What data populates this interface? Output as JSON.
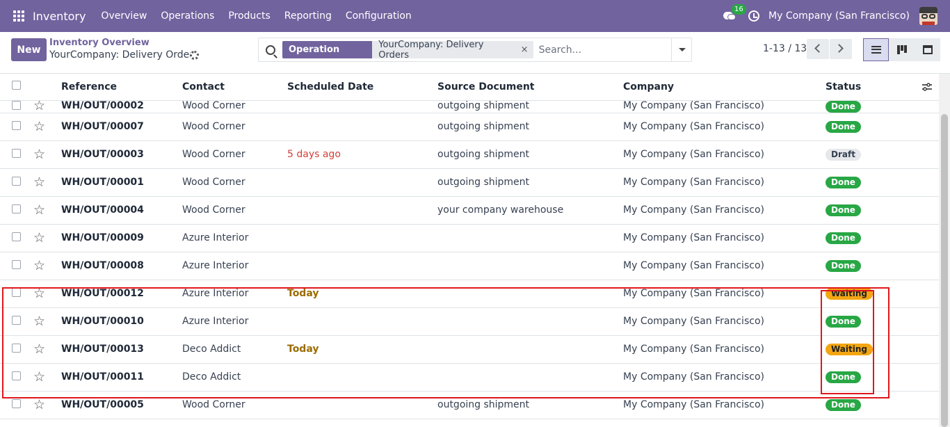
{
  "topbar": {
    "app_name": "Inventory",
    "menu": [
      "Overview",
      "Operations",
      "Products",
      "Reporting",
      "Configuration"
    ],
    "chat_count": "16",
    "company": "My Company (San Francisco)",
    "bg_color": "#71639e"
  },
  "control": {
    "new_label": "New",
    "breadcrumb_parent": "Inventory Overview",
    "breadcrumb_current": "YourCompany: Delivery Orders",
    "facet_label": "Operation Type",
    "facet_value": "YourCompany: Delivery Orders",
    "facet_remove": "×",
    "search_placeholder": "Search...",
    "pager": "1-13 / 13"
  },
  "table": {
    "headers": [
      "Reference",
      "Contact",
      "Scheduled Date",
      "Source Document",
      "Company",
      "Status"
    ],
    "rows": [
      {
        "ref": "WH/OUT/00002",
        "contact": "Wood Corner",
        "date": "",
        "source": "outgoing shipment",
        "company": "My Company (San Francisco)",
        "status": "Done"
      },
      {
        "ref": "WH/OUT/00007",
        "contact": "Wood Corner",
        "date": "",
        "source": "outgoing shipment",
        "company": "My Company (San Francisco)",
        "status": "Done"
      },
      {
        "ref": "WH/OUT/00003",
        "contact": "Wood Corner",
        "date": "5 days ago",
        "source": "outgoing shipment",
        "company": "My Company (San Francisco)",
        "status": "Draft"
      },
      {
        "ref": "WH/OUT/00001",
        "contact": "Wood Corner",
        "date": "",
        "source": "outgoing shipment",
        "company": "My Company (San Francisco)",
        "status": "Done"
      },
      {
        "ref": "WH/OUT/00004",
        "contact": "Wood Corner",
        "date": "",
        "source": "your company warehouse",
        "company": "My Company (San Francisco)",
        "status": "Done"
      },
      {
        "ref": "WH/OUT/00009",
        "contact": "Azure Interior",
        "date": "",
        "source": "",
        "company": "My Company (San Francisco)",
        "status": "Done"
      },
      {
        "ref": "WH/OUT/00008",
        "contact": "Azure Interior",
        "date": "",
        "source": "",
        "company": "My Company (San Francisco)",
        "status": "Done"
      },
      {
        "ref": "WH/OUT/00012",
        "contact": "Azure Interior",
        "date": "Today",
        "source": "",
        "company": "My Company (San Francisco)",
        "status": "Waiting"
      },
      {
        "ref": "WH/OUT/00010",
        "contact": "Azure Interior",
        "date": "",
        "source": "",
        "company": "My Company (San Francisco)",
        "status": "Done"
      },
      {
        "ref": "WH/OUT/00013",
        "contact": "Deco Addict",
        "date": "Today",
        "source": "",
        "company": "My Company (San Francisco)",
        "status": "Waiting"
      },
      {
        "ref": "WH/OUT/00011",
        "contact": "Deco Addict",
        "date": "",
        "source": "",
        "company": "My Company (San Francisco)",
        "status": "Done"
      },
      {
        "ref": "WH/OUT/00005",
        "contact": "Wood Corner",
        "date": "",
        "source": "outgoing shipment",
        "company": "My Company (San Francisco)",
        "status": "Done"
      }
    ]
  },
  "colors": {
    "done": "#28a745",
    "waiting": "#f3a611",
    "draft": "#e5e7eb",
    "late": "#d23f3a",
    "highlight": "#e0161b"
  }
}
